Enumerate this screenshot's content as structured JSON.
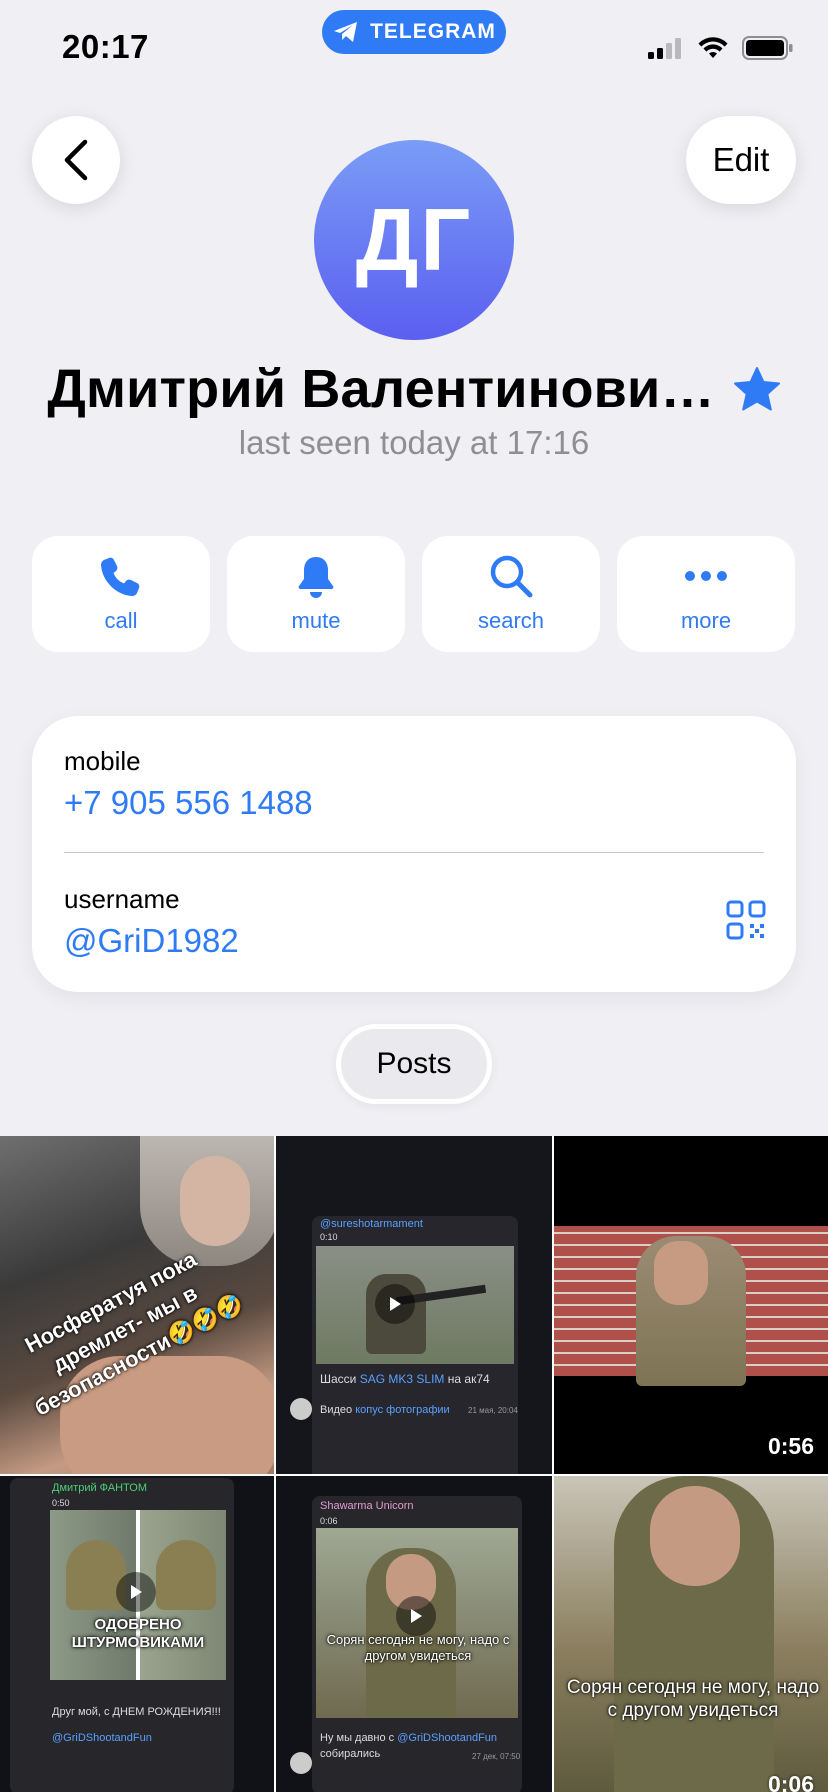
{
  "status_bar": {
    "time": "20:17",
    "app_pill": "TELEGRAM"
  },
  "header": {
    "edit_label": "Edit"
  },
  "profile": {
    "initials": "ДГ",
    "name": "Дмитрий Валентинови…",
    "last_seen": "last seen today at 17:16"
  },
  "actions": [
    {
      "label": "call",
      "icon": "phone-icon"
    },
    {
      "label": "mute",
      "icon": "bell-icon"
    },
    {
      "label": "search",
      "icon": "search-icon"
    },
    {
      "label": "more",
      "icon": "more-icon"
    }
  ],
  "info": {
    "mobile_label": "mobile",
    "mobile_value": "+7 905 556 1488",
    "username_label": "username",
    "username_value": "@GriD1982"
  },
  "tabs": {
    "posts_label": "Posts"
  },
  "posts": [
    {
      "overlay_text": "Носфератуя пока дремлет- мы в безопасности🤣🤣🤣"
    },
    {
      "channel": "@sureshotarmament",
      "duration": "0:10",
      "caption_pre": "Шасси ",
      "caption_link": "SAG MK3 SLIM",
      "caption_post": " на ак74",
      "caption2_pre": "Видео ",
      "caption2_link": "копус фотографии",
      "timestamp": "21 мая, 20:04"
    },
    {
      "duration": "0:56"
    },
    {
      "channel": "Дмитрий ФАНТОМ",
      "duration": "0:50",
      "overlay_text": "ОДОБРЕНО ШТУРМОВИКАМИ",
      "caption": "Друг мой, с ДНЕМ РОЖДЕНИЯ!!!",
      "link": "@GriDShootandFun"
    },
    {
      "channel": "Shawarma Unicorn",
      "duration": "0:06",
      "overlay_text": "Сорян сегодня не могу, надо с другом увидеться",
      "caption_pre": "Ну мы давно с ",
      "caption_link": "@GriDShootandFun",
      "caption_post": "собирались",
      "timestamp": "27 дек, 07:50"
    },
    {
      "overlay_text": "Сорян сегодня не могу, надо с другом увидеться",
      "duration": "0:06"
    }
  ],
  "colors": {
    "accent": "#2f7bf5",
    "background": "#efeff4",
    "avatar_top": "#7a9cf6",
    "avatar_bottom": "#5b5ff0"
  }
}
